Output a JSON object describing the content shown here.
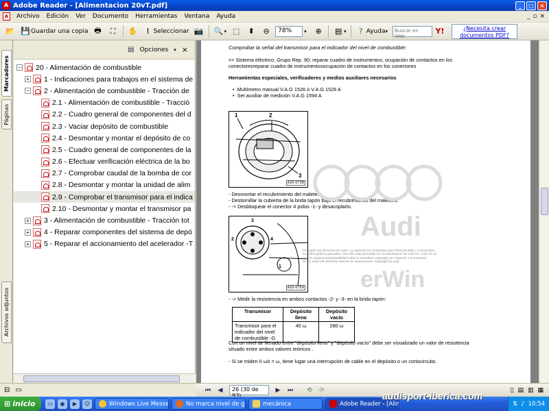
{
  "window": {
    "title": "Adobe Reader - [Alimentacion 20vT.pdf]",
    "app_icon": "adobe-reader-icon"
  },
  "menu": {
    "items": [
      "Archivo",
      "Edición",
      "Ver",
      "Documento",
      "Herramientas",
      "Ventana",
      "Ayuda"
    ]
  },
  "toolbar": {
    "save_copy_label": "Guardar una copia",
    "select_label": "Seleccionar",
    "zoom_value": "78%",
    "help_label": "Ayuda",
    "search_web_placeholder": "Buscar en Web",
    "need_pdf_label": "¿Necesita crear documentos PDF?"
  },
  "left_tabs": {
    "bookmarks": "Marcadores",
    "pages": "Páginas",
    "attachments": "Archivos adjuntos"
  },
  "bookmarks": {
    "options_label": "Opciones",
    "items": [
      {
        "label": "20 - Alimentación de combustible",
        "level": 0,
        "exp": "−"
      },
      {
        "label": "1 - Indicaciones para trabajos en el sistema de",
        "level": 1,
        "exp": "+"
      },
      {
        "label": "2 - Alimentación de combustible - Tracción de",
        "level": 1,
        "exp": "−"
      },
      {
        "label": "2.1 - Alimentación de combustible - Tracció",
        "level": 2,
        "exp": ""
      },
      {
        "label": "2.2 - Cuadro general de componentes del d",
        "level": 2,
        "exp": ""
      },
      {
        "label": "2.3 - Vaciar depósito de combustible",
        "level": 2,
        "exp": ""
      },
      {
        "label": "2.4 - Desmontar y montar el depósito de co",
        "level": 2,
        "exp": ""
      },
      {
        "label": "2.5 - Cuadro general de componentes de la",
        "level": 2,
        "exp": ""
      },
      {
        "label": "2.6 - Efectuar verificación eléctrica de la bo",
        "level": 2,
        "exp": ""
      },
      {
        "label": "2.7 - Comprobar caudal de la bomba de cor",
        "level": 2,
        "exp": ""
      },
      {
        "label": "2.8 - Desmontar y montar la unidad de alim",
        "level": 2,
        "exp": ""
      },
      {
        "label": "2.9 - Comprobar el transmisor para el indica",
        "level": 2,
        "exp": "",
        "selected": true
      },
      {
        "label": "2.10 - Desmontar y montar el transmisor pa",
        "level": 2,
        "exp": ""
      },
      {
        "label": "3 - Alimentación de combustible - Tracción tot",
        "level": 1,
        "exp": "+"
      },
      {
        "label": "4 - Reparar componentes del sistema de depó",
        "level": 1,
        "exp": "+"
      },
      {
        "label": "5 - Reparar el accionamiento del acelerador -T",
        "level": 1,
        "exp": "+"
      }
    ]
  },
  "document": {
    "heading": "Comprobar la señal del transmisor para el indicador del nivel de combustible:",
    "ref_line_1": "=> Sistema eléctrico; Grupo Rep. 90; reparar cuadro de instrumentos; ocupación de contactos en los",
    "ref_line_2": "conectoresreparar cuadro de instrumentosocupación de contactos en los conectores",
    "tools_heading": "Herramientas especiales, verificadores y medios auxiliares necesarios",
    "tools": [
      "Multímetro manual V.A.G 1526 ó V.A.G 1526 A",
      "Set auxiliar de medición V.A.G 1594 A"
    ],
    "fig1_code": "A20-0738",
    "fig1_labels": [
      "2",
      "1",
      "3"
    ],
    "steps1": [
      "-   Desmontar el recubrimiento del maletero.",
      "-   Destornillar la cubierta de la brida tapón bajo el recubrimiento del maletero.",
      "-   -> Desbloquear el conector 4 polos -1- y desacoplarlo."
    ],
    "fig2_code": "A20-0759",
    "fig2_labels": [
      "3",
      "2",
      "4",
      "1"
    ],
    "copyright_1": "Protegido por derechos de autor. La copia de los contenidos para fines privados o comerciales,",
    "copyright_2": "incluidos gráficos parciales, está sólo está permitida con la autorización de Audi AG. Audi AG no",
    "copyright_3": "asume ninguna responsabilidad sobre la exactitud o garantía con respecto a la exactitud",
    "copyright_4": "de los datos del presente manual de reparaciones. Copyright by Audi.",
    "watermark_brand": "Audi",
    "watermark_site": "erWin",
    "measure_step": "-   -> Medir la resistencia en ambos contactos -2- y -3- en la brida tapón:",
    "table": {
      "headers": [
        "Transmisor",
        "Depósito lleno",
        "Depósito vacío"
      ],
      "row": [
        "Transmisor para el indicador del nivel de combustible -G",
        "40 ω",
        "280 ω"
      ]
    },
    "note_1": "Con un nivel de llenado entre \"depósito lleno\" y \"depósito vacío\" debe ser visualizado un valor de resistencia",
    "note_2": "situado entre ambos valores teóricos .",
    "last_step": "-   Si se miden 0 ωó = ω, tiene lugar una interrupción de cable en el depósito o un cortocircuito."
  },
  "nav": {
    "page_value": "26  (30 de 93)"
  },
  "taskbar": {
    "start_label": "inicio",
    "tasks": [
      {
        "label": "Windows Live Messen...",
        "active": false
      },
      {
        "label": "No marca nivel de ga...",
        "active": false
      },
      {
        "label": "mecánica",
        "active": false
      },
      {
        "label": "Adobe Reader - [Alim...",
        "active": true
      }
    ],
    "clock": "10:54",
    "watermark": "audisport-iberica.com"
  },
  "colors": {
    "titlebar": "#0a5ce8",
    "taskbar": "#245edb",
    "start": "#3fb13f",
    "link": "#0000cc"
  }
}
